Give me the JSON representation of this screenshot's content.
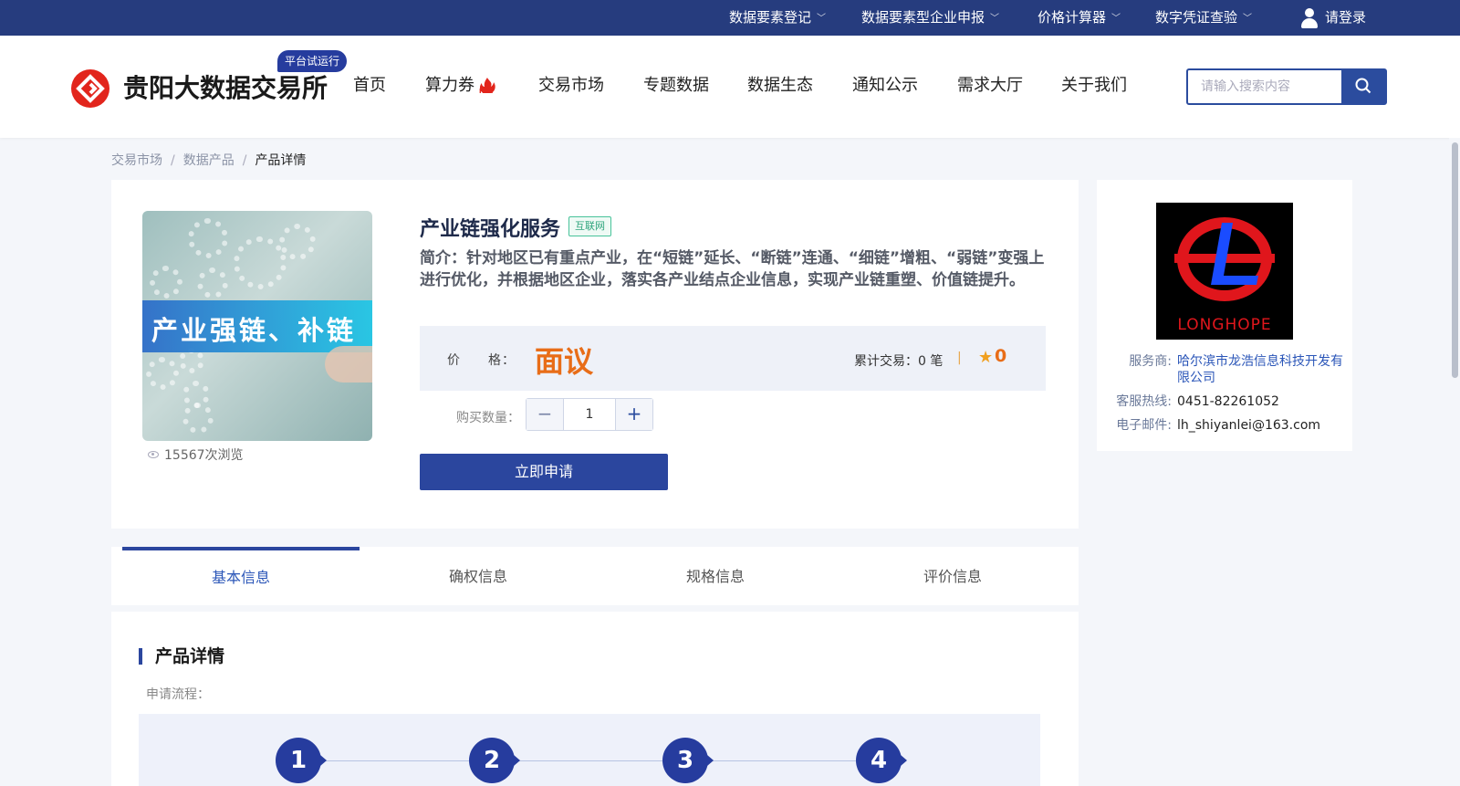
{
  "topbar": {
    "items": [
      {
        "label": "数据要素登记"
      },
      {
        "label": "数据要素型企业申报"
      },
      {
        "label": "价格计算器"
      },
      {
        "label": "数字凭证查验"
      }
    ],
    "login": "请登录"
  },
  "header": {
    "logo_text": "贵阳大数据交易所",
    "trial_badge": "平台试运行",
    "nav": [
      "首页",
      "算力券",
      "交易市场",
      "专题数据",
      "数据生态",
      "通知公示",
      "需求大厅",
      "关于我们"
    ],
    "hot_label": "HOT",
    "search_placeholder": "请输入搜索内容"
  },
  "breadcrumb": [
    "交易市场",
    "数据产品",
    "产品详情"
  ],
  "product": {
    "image_text": "产业强链、补链",
    "views": "15567次浏览",
    "title": "产业链强化服务",
    "tag": "互联网",
    "description": "简介：针对地区已有重点产业，在“短链”延长、“断链”连通、“细链”增粗、“弱链”变强上进行优化，并根据地区企业，落实各产业结点企业信息，实现产业链重塑、价值链提升。",
    "price_label": "价　　格：",
    "price": "面议",
    "trade_count": "累计交易：0 笔",
    "divider": "|",
    "rating": "0",
    "qty_label": "购买数量：",
    "qty_value": "1",
    "minus": "−",
    "plus": "+",
    "apply_button": "立即申请"
  },
  "vendor": {
    "logo_text": "LONGHOPE",
    "provider_key": "服务商:",
    "provider": "哈尔滨市龙浩信息科技开发有限公司",
    "hotline_key": "客服热线:",
    "hotline": "0451-82261052",
    "email_key": "电子邮件:",
    "email": "lh_shiyanlei@163.com"
  },
  "tabs": [
    "基本信息",
    "确权信息",
    "规格信息",
    "评价信息"
  ],
  "details": {
    "section_title": "产品详情",
    "flow_label": "申请流程：",
    "steps": [
      "1",
      "2",
      "3",
      "4"
    ]
  },
  "colors": {
    "topbar": "#263c7e",
    "primary": "#2b469e",
    "price": "#e86d18",
    "brand_red": "#e2251c"
  }
}
